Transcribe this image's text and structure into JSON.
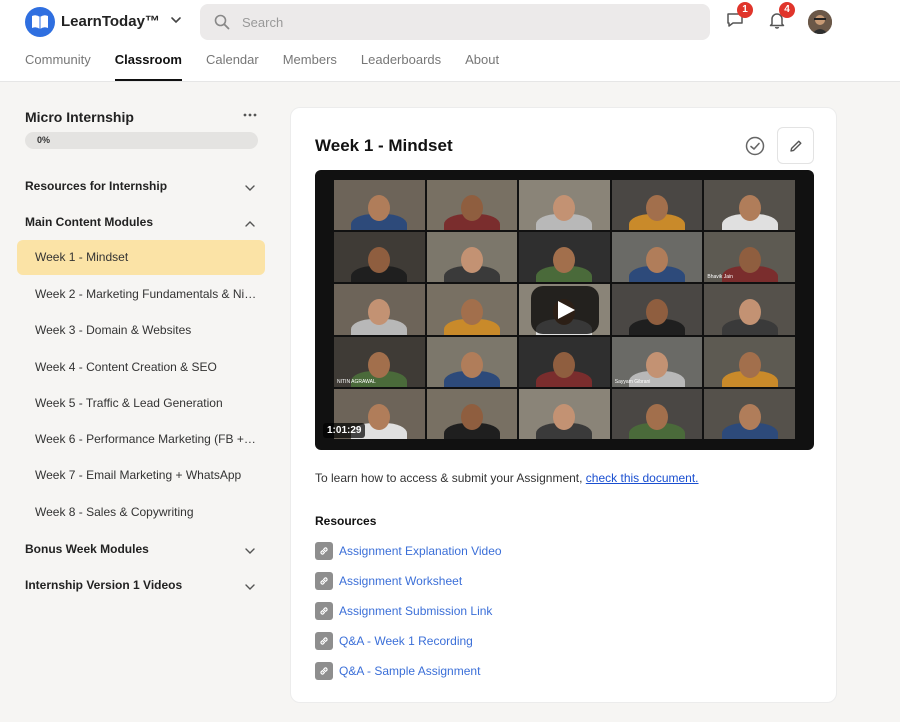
{
  "app": {
    "name": "LearnToday™",
    "search_placeholder": "Search",
    "chat_badge": "1",
    "notif_badge": "4"
  },
  "nav": [
    "Community",
    "Classroom",
    "Calendar",
    "Members",
    "Leaderboards",
    "About"
  ],
  "course": {
    "title": "Micro Internship",
    "progress_label": "0%",
    "progress_value": 0
  },
  "modules": [
    {
      "label": "Resources for Internship"
    },
    {
      "label": "Main Content Modules"
    },
    {
      "label": "Bonus Week Modules"
    },
    {
      "label": "Internship Version 1 Videos"
    }
  ],
  "lessons": [
    "Week 1 - Mindset",
    "Week 2 - Marketing Fundamentals & Nic...",
    "Week 3 - Domain & Websites",
    "Week 4 - Content Creation & SEO",
    "Week 5 - Traffic & Lead Generation",
    "Week 6 - Performance Marketing (FB + ...",
    "Week 7 - Email Marketing + WhatsApp",
    "Week 8 - Sales & Copywriting"
  ],
  "lesson": {
    "title": "Week 1 - Mindset",
    "video_duration": "1:01:29",
    "assign_prefix": "To learn how to access & submit your Assignment, ",
    "assign_link": "check this document.",
    "resources_title": "Resources",
    "resources": [
      "Assignment Explanation Video",
      "Assignment Worksheet",
      "Assignment Submission Link",
      "Q&A - Week 1 Recording",
      "Q&A - Sample Assignment"
    ]
  },
  "video_tiles": [
    "",
    "",
    "",
    "",
    "",
    "",
    "",
    "",
    "",
    "Bhavik Jain",
    "",
    "",
    "",
    "",
    "",
    "NITIN AGRAWAL",
    "",
    "",
    "Sayyam Gibrani",
    "",
    "",
    "",
    "",
    "",
    ""
  ],
  "colors": {
    "accent": "#2f6fe0",
    "active_lesson": "#fbe3a6",
    "link": "#3b6fd8",
    "badge": "#e0352b"
  }
}
